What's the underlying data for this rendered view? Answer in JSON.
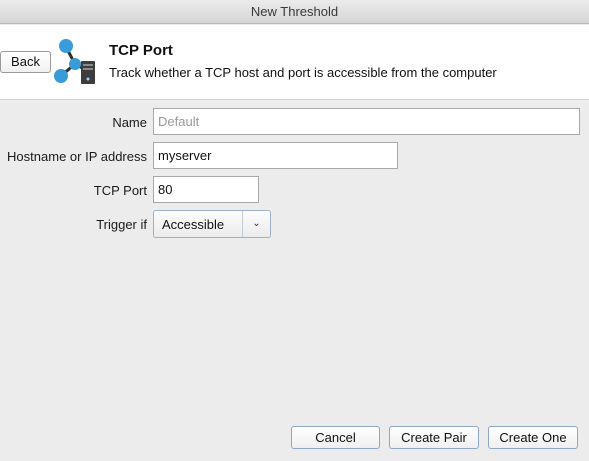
{
  "window": {
    "title": "New Threshold"
  },
  "header": {
    "back_label": "Back",
    "icon": "network-server-icon",
    "title": "TCP Port",
    "description": "Track whether a TCP host and port is accessible from the computer"
  },
  "form": {
    "name": {
      "label": "Name",
      "value": "",
      "placeholder": "Default"
    },
    "host": {
      "label": "Hostname or IP address",
      "value": "myserver"
    },
    "port": {
      "label": "TCP Port",
      "value": "80"
    },
    "trigger": {
      "label": "Trigger if",
      "selected": "Accessible"
    }
  },
  "footer": {
    "cancel_label": "Cancel",
    "create_pair_label": "Create Pair",
    "create_one_label": "Create One"
  },
  "colors": {
    "accent_blue": "#3a9bd9",
    "server_dark": "#3d3d3d"
  }
}
